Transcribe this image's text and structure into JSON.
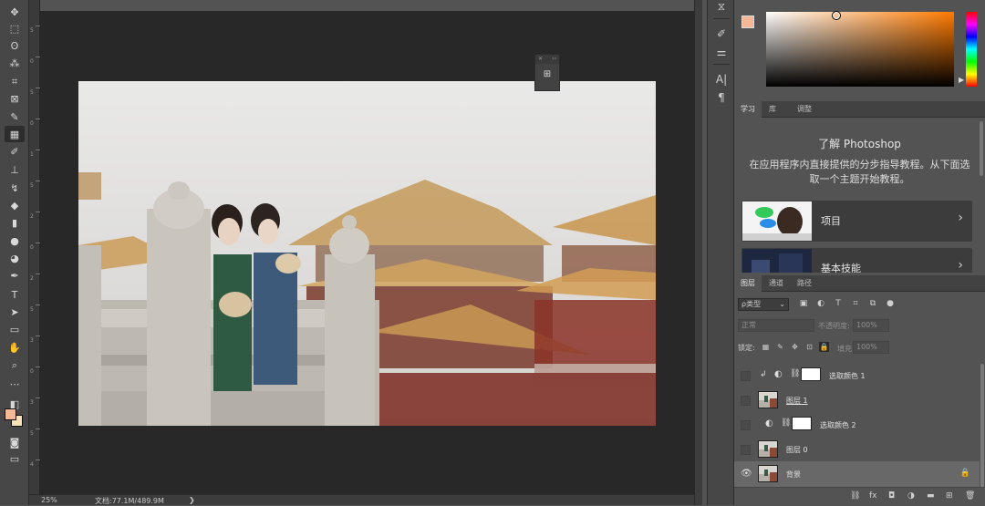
{
  "toolbar": {
    "tools": [
      {
        "name": "move-tool-icon",
        "glyph": "✥"
      },
      {
        "name": "rectangular-marquee-tool-icon",
        "glyph": "⬚"
      },
      {
        "name": "lasso-tool-icon",
        "glyph": "ʘ"
      },
      {
        "name": "magic-wand-tool-icon",
        "glyph": "⁂"
      },
      {
        "name": "crop-tool-icon",
        "glyph": "⌗"
      },
      {
        "name": "frame-tool-icon",
        "glyph": "⊠"
      },
      {
        "name": "eyedropper-tool-icon",
        "glyph": "✎"
      },
      {
        "name": "healing-brush-tool-icon",
        "glyph": "▦"
      },
      {
        "name": "brush-tool-icon",
        "glyph": "✐"
      },
      {
        "name": "clone-stamp-tool-icon",
        "glyph": "⊥"
      },
      {
        "name": "history-brush-tool-icon",
        "glyph": "↯"
      },
      {
        "name": "eraser-tool-icon",
        "glyph": "◆"
      },
      {
        "name": "gradient-tool-icon",
        "glyph": "▮"
      },
      {
        "name": "blur-tool-icon",
        "glyph": "●"
      },
      {
        "name": "dodge-tool-icon",
        "glyph": "◕"
      },
      {
        "name": "pen-tool-icon",
        "glyph": "✒"
      },
      {
        "name": "type-tool-icon",
        "glyph": "T"
      },
      {
        "name": "path-selection-tool-icon",
        "glyph": "➤"
      },
      {
        "name": "rectangle-tool-icon",
        "glyph": "▭"
      },
      {
        "name": "hand-tool-icon",
        "glyph": "✋"
      },
      {
        "name": "zoom-tool-icon",
        "glyph": "⌕"
      },
      {
        "name": "more-tools-icon",
        "glyph": "⋯"
      }
    ],
    "foreground_color": "#f5b896",
    "background_color": "#f6e2b6"
  },
  "ruler_numbers": [
    "5",
    "0",
    "5",
    "0",
    "1",
    "5",
    "2",
    "0",
    "2",
    "5",
    "3",
    "0",
    "3",
    "5",
    "4"
  ],
  "statusbar": {
    "zoom": "25%",
    "doc_info": "文档:77.1M/489.9M",
    "arrow": "❯"
  },
  "mini_panel": {
    "close": "✕",
    "collapse": "››",
    "icon": "⊞"
  },
  "icon_column": [
    {
      "name": "history-icon",
      "glyph": "⧖"
    },
    {
      "name": "brush-settings-icon",
      "glyph": "✐"
    },
    {
      "name": "adjustments-icon",
      "glyph": "⚌"
    },
    {
      "name": "character-icon",
      "glyph": "A|"
    },
    {
      "name": "paragraph-icon",
      "glyph": "¶"
    }
  ],
  "color_panel": {
    "foreground": "#f5b896",
    "background": "#f6e2b6",
    "hue_indicator": "▶"
  },
  "learn_panel": {
    "tabs": [
      "学习",
      "库",
      "调整"
    ],
    "title": "了解 Photoshop",
    "description": "在应用程序内直接提供的分步指导教程。从下面选取一个主题开始教程。",
    "cards": [
      {
        "label": "项目",
        "chevron": "›"
      },
      {
        "label": "基本技能",
        "chevron": "›"
      }
    ]
  },
  "layers_panel": {
    "tabs": [
      "图层",
      "通道",
      "路径"
    ],
    "filter_kind": "ρ类型",
    "filter_dropdown": "⌄",
    "filter_icons": [
      {
        "name": "pixel-filter-icon",
        "glyph": "▣"
      },
      {
        "name": "adjustment-filter-icon",
        "glyph": "◐"
      },
      {
        "name": "type-filter-icon",
        "glyph": "T"
      },
      {
        "name": "shape-filter-icon",
        "glyph": "⌗"
      },
      {
        "name": "smart-object-filter-icon",
        "glyph": "⧉"
      },
      {
        "name": "filter-toggle-icon",
        "glyph": "●"
      }
    ],
    "blend_mode": "正常",
    "opacity_label": "不透明度:",
    "opacity_value": "100%",
    "lock_label": "锁定:",
    "fill_label": "填充:",
    "fill_value": "100%",
    "lock_icons": [
      {
        "name": "lock-transparent-icon",
        "glyph": "▦"
      },
      {
        "name": "lock-image-icon",
        "glyph": "✎"
      },
      {
        "name": "lock-position-icon",
        "glyph": "✥"
      },
      {
        "name": "lock-artboard-icon",
        "glyph": "⊡"
      },
      {
        "name": "lock-all-icon",
        "glyph": "🔒"
      }
    ],
    "layers": [
      {
        "name": "选取颜色 1",
        "visible": false,
        "clipped": true,
        "type": "adjustment",
        "selected": false
      },
      {
        "name": "图层 1",
        "visible": false,
        "clipped": false,
        "type": "pixel",
        "selected": false
      },
      {
        "name": "选取颜色 2",
        "visible": false,
        "clipped": false,
        "type": "adjustment",
        "selected": false
      },
      {
        "name": "图层 0",
        "visible": false,
        "clipped": false,
        "type": "pixel",
        "selected": false
      },
      {
        "name": "背景",
        "visible": true,
        "clipped": false,
        "type": "background",
        "selected": true
      }
    ],
    "clip_glyph": "↲",
    "adj_glyph": "◐",
    "link_glyph": "⛓",
    "eye_glyph": "👁",
    "padlock_glyph": "🔒",
    "footer_icons": [
      {
        "name": "link-layers-icon",
        "glyph": "⛓"
      },
      {
        "name": "layer-style-icon",
        "glyph": "fx"
      },
      {
        "name": "add-mask-icon",
        "glyph": "◘"
      },
      {
        "name": "new-adjustment-icon",
        "glyph": "◑"
      },
      {
        "name": "new-group-icon",
        "glyph": "▬"
      },
      {
        "name": "new-layer-icon",
        "glyph": "⊞"
      },
      {
        "name": "delete-layer-icon",
        "glyph": "🗑"
      }
    ]
  }
}
